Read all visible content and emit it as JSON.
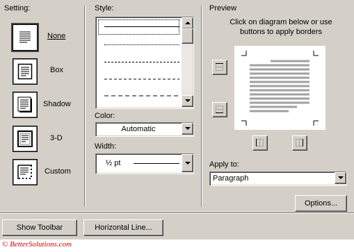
{
  "setting": {
    "label": "Setting:",
    "options": [
      {
        "label": "None",
        "selected": true
      },
      {
        "label": "Box",
        "selected": false
      },
      {
        "label": "Shadow",
        "selected": false
      },
      {
        "label": "3-D",
        "selected": false
      },
      {
        "label": "Custom",
        "selected": false
      }
    ]
  },
  "style": {
    "label": "Style:",
    "line_styles": [
      "solid",
      "dotted",
      "dashed-small",
      "dashed-medium",
      "dashed-large"
    ],
    "selected_index": 0
  },
  "color": {
    "label": "Color:",
    "value": "Automatic"
  },
  "width": {
    "label": "Width:",
    "value": "½ pt"
  },
  "preview": {
    "label": "Preview",
    "instructions": "Click on diagram below or use buttons to apply borders"
  },
  "apply_to": {
    "label": "Apply to:",
    "value": "Paragraph"
  },
  "buttons": {
    "options": "Options...",
    "show_toolbar": "Show Toolbar",
    "horizontal_line": "Horizontal Line..."
  },
  "watermark": "© BetterSolutions.com",
  "colors": {
    "dialog_bg": "#d4d0c8",
    "watermark": "#cc0000"
  }
}
